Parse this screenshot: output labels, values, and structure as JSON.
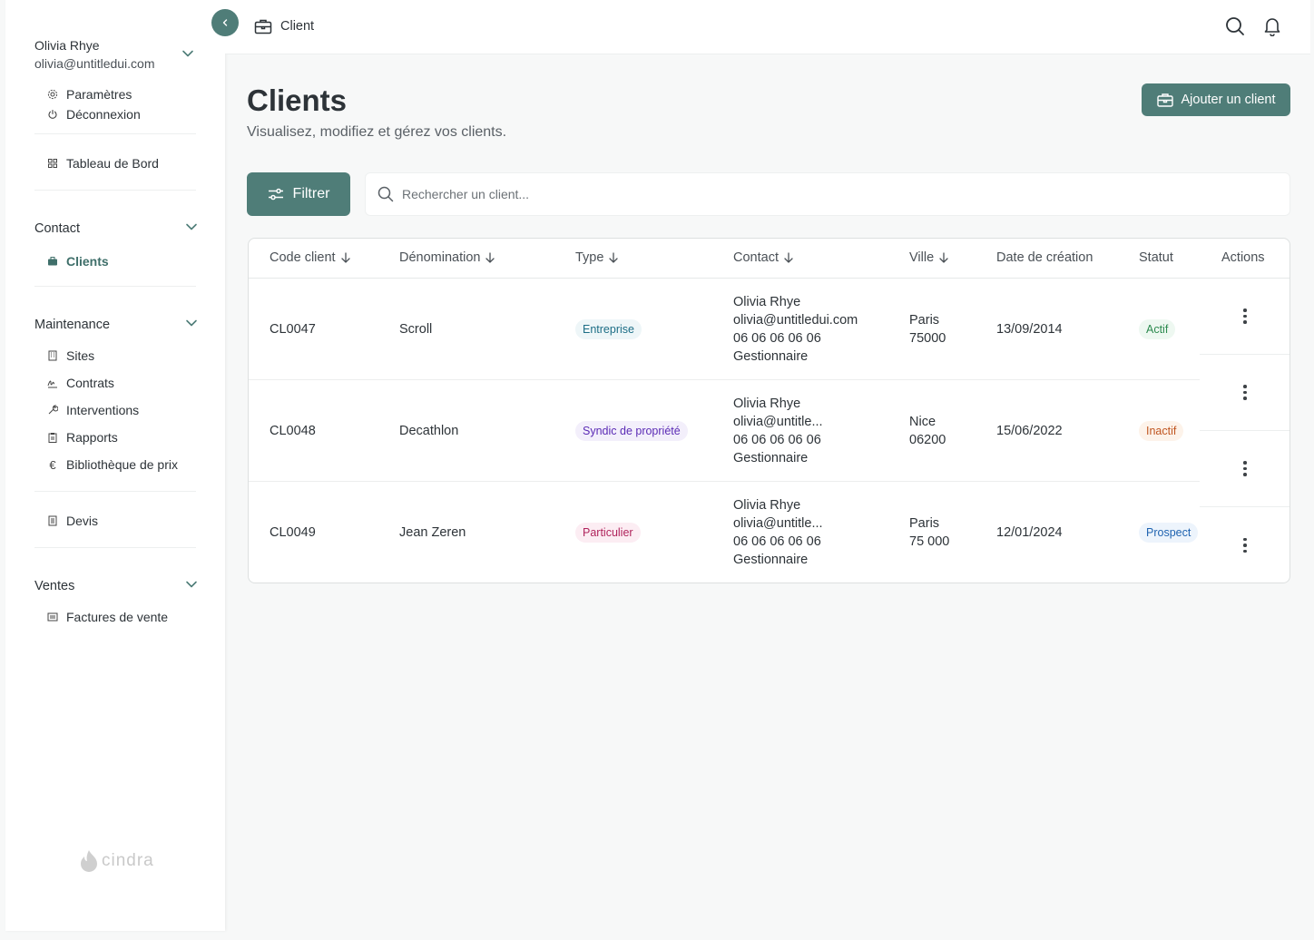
{
  "user": {
    "name": "Olivia Rhye",
    "email": "olivia@untitledui.com"
  },
  "account_menu": [
    {
      "label": "Paramètres",
      "icon": "gear-icon"
    },
    {
      "label": "Déconnexion",
      "icon": "power-icon"
    }
  ],
  "dashboard_label": "Tableau de Bord",
  "sections": {
    "contact": {
      "title": "Contact",
      "items": [
        {
          "label": "Clients",
          "icon": "briefcase-icon",
          "active": true
        }
      ]
    },
    "maintenance": {
      "title": "Maintenance",
      "items": [
        {
          "label": "Sites",
          "icon": "building-icon"
        },
        {
          "label": "Contrats",
          "icon": "signature-icon"
        },
        {
          "label": "Interventions",
          "icon": "wrench-icon"
        },
        {
          "label": "Rapports",
          "icon": "clipboard-icon"
        },
        {
          "label": "Bibliothèque de prix",
          "icon": "euro-icon"
        }
      ]
    },
    "devis_label": "Devis",
    "ventes": {
      "title": "Ventes",
      "items": [
        {
          "label": "Factures de vente",
          "icon": "invoice-icon"
        }
      ]
    }
  },
  "logo_text": "cindra",
  "topbar": {
    "breadcrumb": "Client"
  },
  "header": {
    "title": "Clients",
    "subtitle": "Visualisez, modifiez et gérez vos clients.",
    "add_button": "Ajouter un client"
  },
  "toolbar": {
    "filter_label": "Filtrer",
    "search_placeholder": "Rechercher un client..."
  },
  "table": {
    "columns": [
      "Code client",
      "Dénomination",
      "Type",
      "Contact",
      "Ville",
      "Date de création",
      "Statut",
      "Actions"
    ],
    "rows": [
      {
        "code": "CL0047",
        "name": "Scroll",
        "type": "Entreprise",
        "contact": [
          "Olivia Rhye",
          "olivia@untitledui.com",
          "06 06 06 06 06",
          "Gestionnaire"
        ],
        "city": "Paris",
        "zip": "75000",
        "date": "13/09/2014",
        "status": "Actif"
      },
      {
        "code": "CL0048",
        "name": "Decathlon",
        "type": "Syndic de propriété",
        "contact": [
          "Olivia Rhye",
          "olivia@untitle...",
          "06 06 06 06 06",
          "Gestionnaire"
        ],
        "city": "Nice",
        "zip": "06200",
        "date": "15/06/2022",
        "status": "Inactif"
      },
      {
        "code": "CL0049",
        "name": "Jean Zeren",
        "type": "Particulier",
        "contact": [
          "Olivia Rhye",
          "olivia@untitle...",
          "06 06 06 06 06",
          "Gestionnaire"
        ],
        "city": "Paris",
        "zip": "75 000",
        "date": "12/01/2024",
        "status": "Prospect"
      }
    ]
  },
  "colors": {
    "accent": "#4f7d78",
    "type_entreprise": "#1d6e86",
    "type_syndic": "#5b2bb5",
    "type_particulier": "#b0245c",
    "status_actif": "#2c8a4e",
    "status_inactif": "#c05621",
    "status_prospect": "#1f63b0"
  }
}
